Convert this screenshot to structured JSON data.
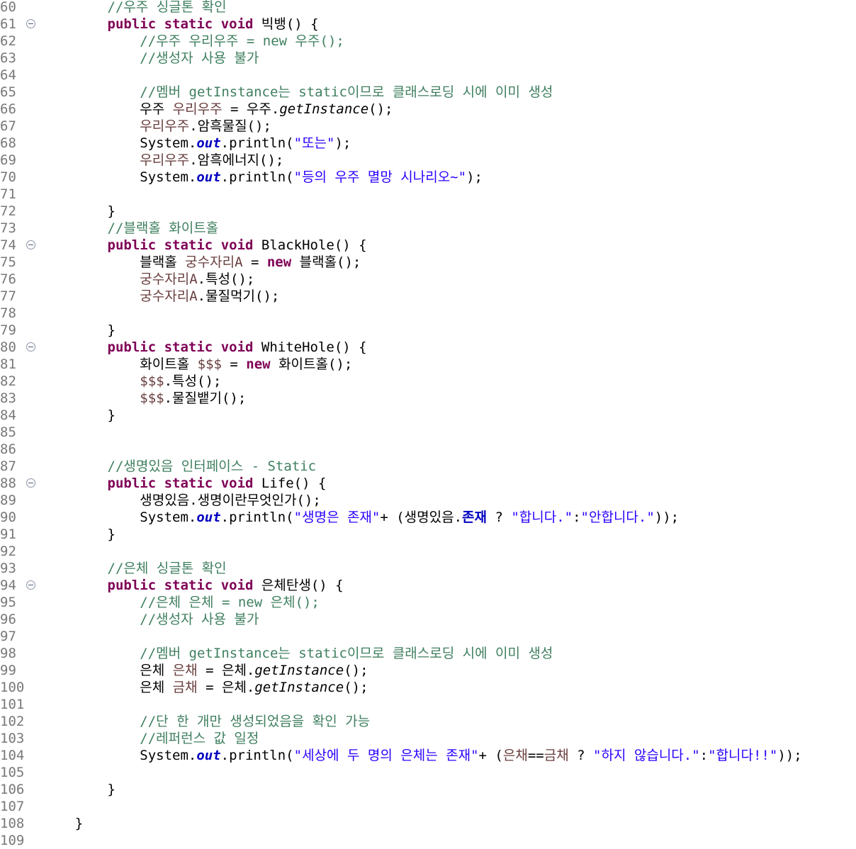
{
  "editor": {
    "lines": [
      {
        "n": "60",
        "fold": false,
        "tokens": [
          {
            "t": "        "
          },
          {
            "t": "//우주 싱글톤 확인",
            "c": "cm"
          }
        ]
      },
      {
        "n": "61",
        "fold": true,
        "tokens": [
          {
            "t": "        "
          },
          {
            "t": "public",
            "c": "kw"
          },
          {
            "t": " "
          },
          {
            "t": "static",
            "c": "kw"
          },
          {
            "t": " "
          },
          {
            "t": "void",
            "c": "kw"
          },
          {
            "t": " 빅뱅() {"
          }
        ]
      },
      {
        "n": "62",
        "fold": false,
        "tokens": [
          {
            "t": "            "
          },
          {
            "t": "//우주 우리우주 = new 우주();",
            "c": "cm"
          }
        ]
      },
      {
        "n": "63",
        "fold": false,
        "tokens": [
          {
            "t": "            "
          },
          {
            "t": "//생성자 사용 불가",
            "c": "cm"
          }
        ]
      },
      {
        "n": "64",
        "fold": false,
        "tokens": []
      },
      {
        "n": "65",
        "fold": false,
        "tokens": [
          {
            "t": "            "
          },
          {
            "t": "//멤버 getInstance는 static이므로 클래스로딩 시에 이미 생성",
            "c": "cm"
          }
        ]
      },
      {
        "n": "66",
        "fold": false,
        "tokens": [
          {
            "t": "            우주 "
          },
          {
            "t": "우리우주",
            "c": "var"
          },
          {
            "t": " = 우주."
          },
          {
            "t": "getInstance",
            "c": "mi"
          },
          {
            "t": "();"
          }
        ]
      },
      {
        "n": "67",
        "fold": false,
        "tokens": [
          {
            "t": "            "
          },
          {
            "t": "우리우주",
            "c": "var"
          },
          {
            "t": ".암흑물질();"
          }
        ]
      },
      {
        "n": "68",
        "fold": false,
        "tokens": [
          {
            "t": "            System."
          },
          {
            "t": "out",
            "c": "fld"
          },
          {
            "t": ".println("
          },
          {
            "t": "\"또는\"",
            "c": "st"
          },
          {
            "t": ");"
          }
        ]
      },
      {
        "n": "69",
        "fold": false,
        "tokens": [
          {
            "t": "            "
          },
          {
            "t": "우리우주",
            "c": "var"
          },
          {
            "t": ".암흑에너지();"
          }
        ]
      },
      {
        "n": "70",
        "fold": false,
        "tokens": [
          {
            "t": "            System."
          },
          {
            "t": "out",
            "c": "fld"
          },
          {
            "t": ".println("
          },
          {
            "t": "\"등의 우주 멸망 시나리오~\"",
            "c": "st"
          },
          {
            "t": ");"
          }
        ]
      },
      {
        "n": "71",
        "fold": false,
        "tokens": []
      },
      {
        "n": "72",
        "fold": false,
        "tokens": [
          {
            "t": "        }"
          }
        ]
      },
      {
        "n": "73",
        "fold": false,
        "tokens": [
          {
            "t": "        "
          },
          {
            "t": "//블랙홀 화이트홀",
            "c": "cm"
          }
        ]
      },
      {
        "n": "74",
        "fold": true,
        "tokens": [
          {
            "t": "        "
          },
          {
            "t": "public",
            "c": "kw"
          },
          {
            "t": " "
          },
          {
            "t": "static",
            "c": "kw"
          },
          {
            "t": " "
          },
          {
            "t": "void",
            "c": "kw"
          },
          {
            "t": " BlackHole() {"
          }
        ]
      },
      {
        "n": "75",
        "fold": false,
        "tokens": [
          {
            "t": "            블랙홀 "
          },
          {
            "t": "궁수자리A",
            "c": "var"
          },
          {
            "t": " = "
          },
          {
            "t": "new",
            "c": "kw"
          },
          {
            "t": " 블랙홀();"
          }
        ]
      },
      {
        "n": "76",
        "fold": false,
        "tokens": [
          {
            "t": "            "
          },
          {
            "t": "궁수자리A",
            "c": "var"
          },
          {
            "t": ".특성();"
          }
        ]
      },
      {
        "n": "77",
        "fold": false,
        "tokens": [
          {
            "t": "            "
          },
          {
            "t": "궁수자리A",
            "c": "var"
          },
          {
            "t": ".물질먹기();"
          }
        ]
      },
      {
        "n": "78",
        "fold": false,
        "tokens": []
      },
      {
        "n": "79",
        "fold": false,
        "tokens": [
          {
            "t": "        }"
          }
        ]
      },
      {
        "n": "80",
        "fold": true,
        "tokens": [
          {
            "t": "        "
          },
          {
            "t": "public",
            "c": "kw"
          },
          {
            "t": " "
          },
          {
            "t": "static",
            "c": "kw"
          },
          {
            "t": " "
          },
          {
            "t": "void",
            "c": "kw"
          },
          {
            "t": " WhiteHole() {"
          }
        ]
      },
      {
        "n": "81",
        "fold": false,
        "tokens": [
          {
            "t": "            화이트홀 "
          },
          {
            "t": "$$$",
            "c": "var"
          },
          {
            "t": " = "
          },
          {
            "t": "new",
            "c": "kw"
          },
          {
            "t": " 화이트홀();"
          }
        ]
      },
      {
        "n": "82",
        "fold": false,
        "tokens": [
          {
            "t": "            "
          },
          {
            "t": "$$$",
            "c": "var"
          },
          {
            "t": ".특성();"
          }
        ]
      },
      {
        "n": "83",
        "fold": false,
        "tokens": [
          {
            "t": "            "
          },
          {
            "t": "$$$",
            "c": "var"
          },
          {
            "t": ".물질뱉기();"
          }
        ]
      },
      {
        "n": "84",
        "fold": false,
        "tokens": [
          {
            "t": "        }"
          }
        ]
      },
      {
        "n": "85",
        "fold": false,
        "tokens": []
      },
      {
        "n": "86",
        "fold": false,
        "tokens": []
      },
      {
        "n": "87",
        "fold": false,
        "tokens": [
          {
            "t": "        "
          },
          {
            "t": "//생명있음 인터페이스 - Static",
            "c": "cm"
          }
        ]
      },
      {
        "n": "88",
        "fold": true,
        "tokens": [
          {
            "t": "        "
          },
          {
            "t": "public",
            "c": "kw"
          },
          {
            "t": " "
          },
          {
            "t": "static",
            "c": "kw"
          },
          {
            "t": " "
          },
          {
            "t": "void",
            "c": "kw"
          },
          {
            "t": " Life() {"
          }
        ]
      },
      {
        "n": "89",
        "fold": false,
        "tokens": [
          {
            "t": "            생명있음.생명이란무엇인가();"
          }
        ]
      },
      {
        "n": "90",
        "fold": false,
        "tokens": [
          {
            "t": "            System."
          },
          {
            "t": "out",
            "c": "fld"
          },
          {
            "t": ".println("
          },
          {
            "t": "\"생명은 존재\"",
            "c": "st"
          },
          {
            "t": "+ (생명있음."
          },
          {
            "t": "존재",
            "c": "sfld"
          },
          {
            "t": " ? "
          },
          {
            "t": "\"합니다.\"",
            "c": "st"
          },
          {
            "t": ":"
          },
          {
            "t": "\"안합니다.\"",
            "c": "st"
          },
          {
            "t": "));"
          }
        ]
      },
      {
        "n": "91",
        "fold": false,
        "tokens": [
          {
            "t": "        }"
          }
        ]
      },
      {
        "n": "92",
        "fold": false,
        "tokens": []
      },
      {
        "n": "93",
        "fold": false,
        "tokens": [
          {
            "t": "        "
          },
          {
            "t": "//은체 싱글톤 확인",
            "c": "cm"
          }
        ]
      },
      {
        "n": "94",
        "fold": true,
        "tokens": [
          {
            "t": "        "
          },
          {
            "t": "public",
            "c": "kw"
          },
          {
            "t": " "
          },
          {
            "t": "static",
            "c": "kw"
          },
          {
            "t": " "
          },
          {
            "t": "void",
            "c": "kw"
          },
          {
            "t": " 은체탄생() {"
          }
        ]
      },
      {
        "n": "95",
        "fold": false,
        "tokens": [
          {
            "t": "            "
          },
          {
            "t": "//은체 은체 = new 은체();",
            "c": "cm"
          }
        ]
      },
      {
        "n": "96",
        "fold": false,
        "tokens": [
          {
            "t": "            "
          },
          {
            "t": "//생성자 사용 불가",
            "c": "cm"
          }
        ]
      },
      {
        "n": "97",
        "fold": false,
        "tokens": []
      },
      {
        "n": "98",
        "fold": false,
        "tokens": [
          {
            "t": "            "
          },
          {
            "t": "//멤버 getInstance는 static이므로 클래스로딩 시에 이미 생성",
            "c": "cm"
          }
        ]
      },
      {
        "n": "99",
        "fold": false,
        "tokens": [
          {
            "t": "            은체 "
          },
          {
            "t": "은채",
            "c": "var"
          },
          {
            "t": " = 은체."
          },
          {
            "t": "getInstance",
            "c": "mi"
          },
          {
            "t": "();"
          }
        ]
      },
      {
        "n": "100",
        "fold": false,
        "tokens": [
          {
            "t": "            은체 "
          },
          {
            "t": "금채",
            "c": "var"
          },
          {
            "t": " = 은체."
          },
          {
            "t": "getInstance",
            "c": "mi"
          },
          {
            "t": "();"
          }
        ]
      },
      {
        "n": "101",
        "fold": false,
        "tokens": []
      },
      {
        "n": "102",
        "fold": false,
        "tokens": [
          {
            "t": "            "
          },
          {
            "t": "//단 한 개만 생성되었음을 확인 가능",
            "c": "cm"
          }
        ]
      },
      {
        "n": "103",
        "fold": false,
        "tokens": [
          {
            "t": "            "
          },
          {
            "t": "//레퍼런스 값 일정",
            "c": "cm"
          }
        ]
      },
      {
        "n": "104",
        "fold": false,
        "tokens": [
          {
            "t": "            System."
          },
          {
            "t": "out",
            "c": "fld"
          },
          {
            "t": ".println("
          },
          {
            "t": "\"세상에 두 명의 은체는 존재\"",
            "c": "st"
          },
          {
            "t": "+ ("
          },
          {
            "t": "은채",
            "c": "var"
          },
          {
            "t": "=="
          },
          {
            "t": "금채",
            "c": "var"
          },
          {
            "t": " ? "
          },
          {
            "t": "\"하지 않습니다.\"",
            "c": "st"
          },
          {
            "t": ":"
          },
          {
            "t": "\"합니다!!\"",
            "c": "st"
          },
          {
            "t": "));"
          }
        ]
      },
      {
        "n": "105",
        "fold": false,
        "tokens": []
      },
      {
        "n": "106",
        "fold": false,
        "tokens": [
          {
            "t": "        }"
          }
        ]
      },
      {
        "n": "107",
        "fold": false,
        "tokens": []
      },
      {
        "n": "108",
        "fold": false,
        "tokens": [
          {
            "t": "    }"
          }
        ]
      },
      {
        "n": "109",
        "fold": false,
        "tokens": []
      }
    ]
  },
  "icons": {
    "fold": "collapse-minus-icon"
  },
  "colors": {
    "keyword": "#7f0055",
    "comment": "#3f7f5f",
    "string": "#2a00ff",
    "field": "#0000c0",
    "local_variable": "#6a3e3e",
    "line_number": "#787878"
  }
}
